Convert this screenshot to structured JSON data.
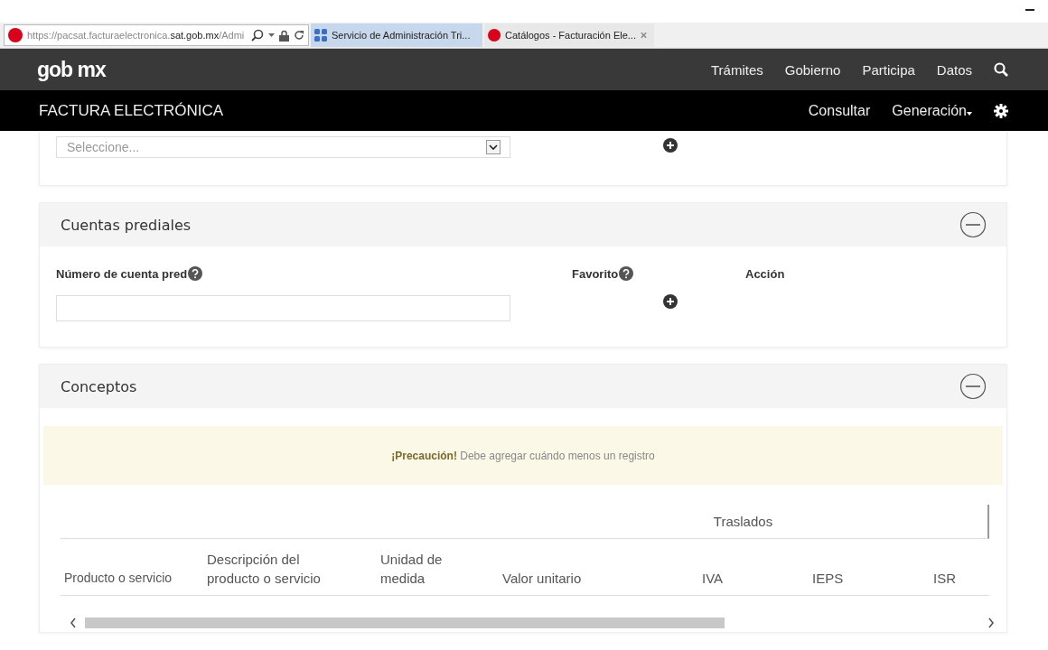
{
  "browser": {
    "address": "https://pacsat.facturaelectronica.**sat.gob.mx**/Admi",
    "tabs": [
      {
        "label": "Servicio de Administración Tri...",
        "selected": false
      },
      {
        "label": "Catálogos - Facturación Ele...",
        "selected": true
      }
    ]
  },
  "header": {
    "logo": "gob mx",
    "nav": [
      "Trámites",
      "Gobierno",
      "Participa",
      "Datos"
    ]
  },
  "subheader": {
    "title": "FACTURA ELECTRÓNICA",
    "nav": [
      {
        "label": "Consultar",
        "dropdown": false
      },
      {
        "label": "Generación",
        "dropdown": true
      }
    ]
  },
  "top_card": {
    "select": {
      "value": "Seleccione..."
    }
  },
  "sections": [
    {
      "kind": "form",
      "title": "Cuentas prediales",
      "expanded": true,
      "labels": [
        {
          "label": "Número de cuenta pred",
          "help": true
        },
        {
          "label": "Favorito",
          "help": true
        },
        {
          "label": "Acción",
          "help": false
        }
      ]
    },
    {
      "kind": "table",
      "title": "Conceptos",
      "expanded": true,
      "alert": "**¡Precaución!** Debe agregar cuándo menos un registro",
      "group_header": "Traslados",
      "columns": [
        "Producto o servicio",
        "Descripción del producto o servicio",
        "Unidad de medida",
        "Valor unitario",
        "IVA",
        "IEPS",
        "ISR"
      ]
    }
  ]
}
